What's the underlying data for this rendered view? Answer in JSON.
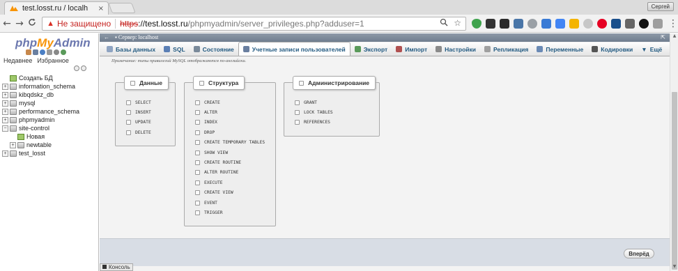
{
  "browser": {
    "tab_title": "test.losst.ru / localh",
    "tab_close": "×",
    "profile_name": "Сергей",
    "back": "←",
    "forward": "→",
    "reload": "C",
    "security_label": "Не защищено",
    "url_scheme": "https",
    "url_host": "://test.losst.ru",
    "url_path": "/phpmyadmin/server_privileges.php?adduser=1",
    "menu": "⋮"
  },
  "sidebar": {
    "logo_php": "php",
    "logo_my": "My",
    "logo_admin": "Admin",
    "recent_label": "Недавнее",
    "favorites_label": "Избранное",
    "databases": [
      {
        "name": "Создать БД"
      },
      {
        "name": "information_schema"
      },
      {
        "name": "kibqdskz_db"
      },
      {
        "name": "mysql"
      },
      {
        "name": "performance_schema"
      },
      {
        "name": "phpmyadmin"
      },
      {
        "name": "site-control"
      },
      {
        "name": "Новая"
      },
      {
        "name": "newtable"
      },
      {
        "name": "test_losst"
      }
    ]
  },
  "main": {
    "server_label": "Сервер: localhost",
    "tabs": [
      {
        "label": "Базы данных",
        "color": "#8fa4c2"
      },
      {
        "label": "SQL",
        "color": "#5b7fb5"
      },
      {
        "label": "Состояние",
        "color": "#7a8a9a"
      },
      {
        "label": "Учетные записи пользователей",
        "color": "#6a7fa0"
      },
      {
        "label": "Экспорт",
        "color": "#5a9a5a"
      },
      {
        "label": "Импорт",
        "color": "#b05050"
      },
      {
        "label": "Настройки",
        "color": "#8a8a8a"
      },
      {
        "label": "Репликация",
        "color": "#a0a0a0"
      },
      {
        "label": "Переменные",
        "color": "#6a8ab5"
      },
      {
        "label": "Кодировки",
        "color": "#555555"
      },
      {
        "label": "Ещё",
        "color": "#333333"
      }
    ],
    "note": "Примечание: типы привилегий MySQL отображаются по-английски.",
    "groups": {
      "data": {
        "legend": "Данные",
        "items": [
          "SELECT",
          "INSERT",
          "UPDATE",
          "DELETE"
        ]
      },
      "structure": {
        "legend": "Структура",
        "items": [
          "CREATE",
          "ALTER",
          "INDEX",
          "DROP",
          "CREATE TEMPORARY TABLES",
          "SHOW VIEW",
          "CREATE ROUTINE",
          "ALTER ROUTINE",
          "EXECUTE",
          "CREATE VIEW",
          "EVENT",
          "TRIGGER"
        ]
      },
      "admin": {
        "legend": "Администрирование",
        "items": [
          "GRANT",
          "LOCK TABLES",
          "REFERENCES"
        ]
      }
    },
    "go_button": "Вперёд",
    "console_label": "Консоль"
  }
}
